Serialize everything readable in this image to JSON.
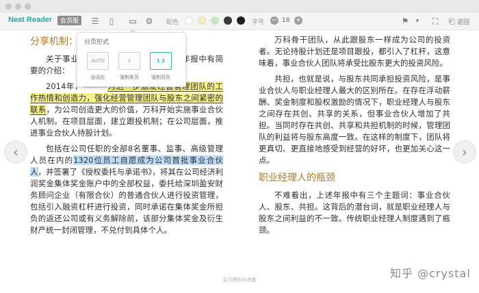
{
  "toolbar": {
    "app_name": "Neat Reader",
    "edition_badge": "会员版",
    "icons": [
      "list-icon",
      "book-icon",
      "layout-icon",
      "gear-icon",
      "bookmark-icon",
      "fullscreen-icon",
      "back-icon"
    ],
    "color_label": "配色",
    "swatches": [
      "#ffffff",
      "#f3ecc2",
      "#c7e6c3",
      "#3a3a3a",
      "#1e1e1e"
    ],
    "fontsize_label": "字号",
    "fontsize_value": "18",
    "back_label": "返回"
  },
  "popup": {
    "title": "分页形式",
    "options": [
      {
        "mode": "AUTO",
        "label": "自适应"
      },
      {
        "mode": "1",
        "label": "强制单页"
      },
      {
        "mode": "1 2",
        "label": "强制双页"
      }
    ],
    "selected": "强制双页"
  },
  "left_page": {
    "heading": "分享机制：",
    "p1": "关于事业合伙人机制，万科在2015年年报中有简要的介绍：",
    "p2a": "2014年，",
    "note_tag": "66",
    "p2b_hl": "为进一步激发经营管理团队的工作热情和创造力，强化经营管理团队与股东之间紧密的联系",
    "p2c": "，为公司创造更大的价值，万科开始实施事业合伙人机制。在项目层面，建立跟投机制；在公司层面，推进事业合伙人持股计划。",
    "p3a": "包括在公司任职的全部8名董事、监事、高级管理人员在内的",
    "p3b_hl": "1320位员工自愿成为公司首批事业合伙人",
    "p3c": "，并签署了《授权委托与承诺书》，将其在公司经济利润奖金集体奖金账户中的全部权益，委托给深圳盈安财务顾问企业（有限合伙）的普通合伙人进行投资管理，包括引入融资杠杆进行投资，同时承诺在集体奖金所担负的返还公司或有义务解除前，该部分集体奖金及衍生财产统一封闭管理，不兑付到具体个人。"
  },
  "right_page": {
    "p1": "万科骨干团队，从此跟股东一样成为公司的投资者。无论持股计划还是项目跟投，都引入了杠杆，这意味着，事业合伙人团队将承受比股东更大的投资风险。",
    "p2": "共担，也就是说，与股东共同承担投资风险，是事业合伙人与职业经理人最大的区别所在。在存在浮动薪酬、奖金制度和股权激励的情况下，职业经理人与股东之间存在共创、共享的关系，但事业合伙人增加了共担。当同时存在共创、共享和共担机制的时候，管理团队的利益将与股东高度一致。在这样的制度下，团队将更真切、更直接地感受到经营的好坏，也更加关心这一点。",
    "heading": "职业经理人的瓶颈",
    "p3": "不难看出，上述年报中有三个主题词：事业合伙人、股东、共担。这背后的潜台词，就是职业经理人与股东之间利益的不一致。传统职业经理人制度遇到了瓶颈。"
  },
  "footer": {
    "progress_text": "显示资料与进度",
    "watermark": "知乎 @crystal"
  }
}
